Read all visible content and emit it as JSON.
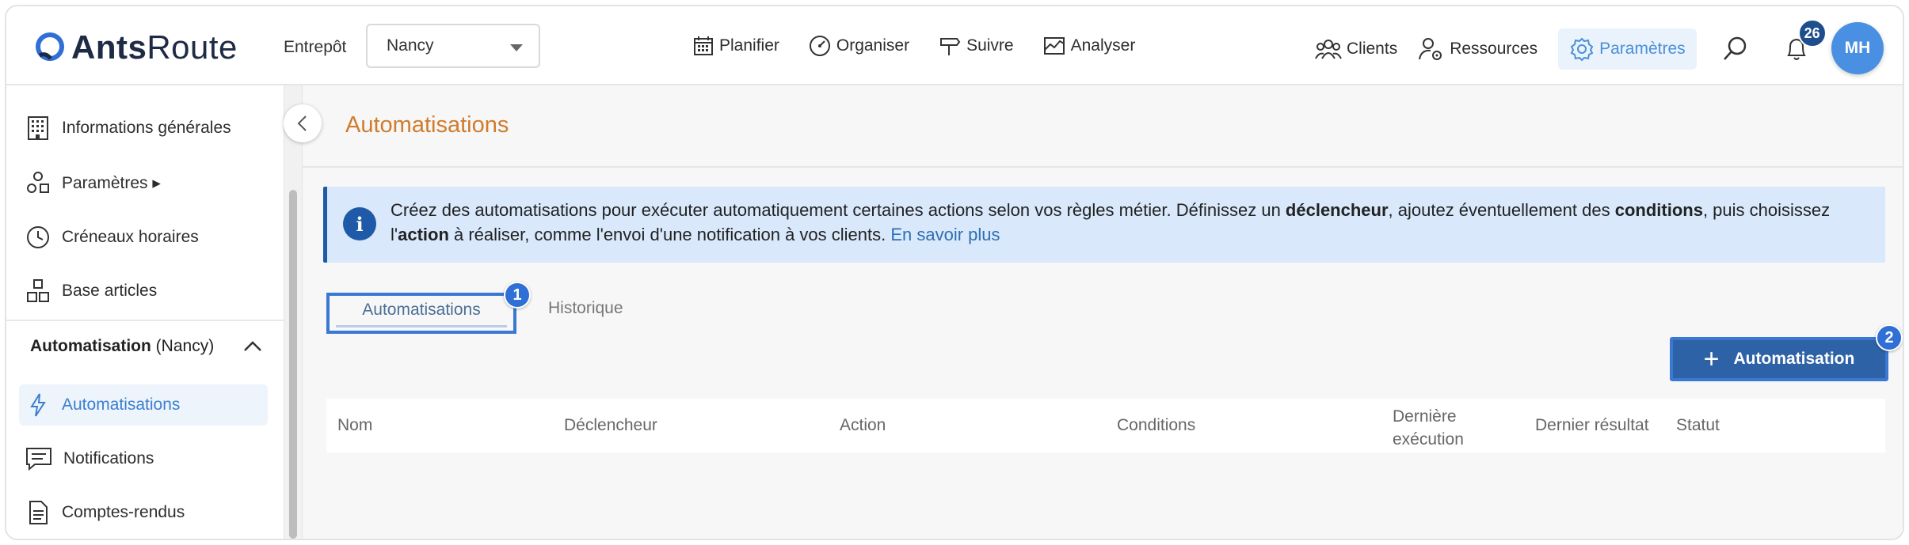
{
  "brand": {
    "name_bold": "Ants",
    "name_light": "Route"
  },
  "header": {
    "warehouse_label": "Entrepôt",
    "warehouse_value": "Nancy",
    "nav": [
      {
        "label": "Planifier",
        "icon": "calendar-icon"
      },
      {
        "label": "Organiser",
        "icon": "speedometer-icon"
      },
      {
        "label": "Suivre",
        "icon": "signpost-icon"
      },
      {
        "label": "Analyser",
        "icon": "chart-icon"
      }
    ],
    "nav_right": [
      {
        "label": "Clients",
        "icon": "users-icon"
      },
      {
        "label": "Ressources",
        "icon": "user-gear-icon"
      },
      {
        "label": "Paramètres",
        "icon": "gear-icon"
      }
    ],
    "notifications_count": "26",
    "avatar_initials": "MH"
  },
  "sidebar": {
    "items": [
      {
        "label": "Informations générales"
      },
      {
        "label": "Paramètres ▸"
      },
      {
        "label": "Créneaux horaires"
      },
      {
        "label": "Base articles"
      }
    ],
    "group_bold": "Automatisation",
    "group_rest": " (Nancy)",
    "sub_items": [
      {
        "label": "Automatisations"
      },
      {
        "label": "Notifications"
      },
      {
        "label": "Comptes-rendus"
      }
    ]
  },
  "main": {
    "title": "Automatisations",
    "info": {
      "t1": "Créez des automatisations pour exécuter automatiquement certaines actions selon vos règles métier. Définissez un ",
      "b1": "déclencheur",
      "t2": ", ajoutez éventuellement des ",
      "b2": "conditions",
      "t3": ", puis choisissez l'",
      "b3": "action",
      "t4": " à réaliser, comme l'envoi d'une notification à vos clients. ",
      "link": "En savoir plus"
    },
    "tabs": [
      {
        "label": "Automatisations"
      },
      {
        "label": "Historique"
      }
    ],
    "markers": [
      "1",
      "2"
    ],
    "add_button": "Automatisation",
    "columns": [
      "Nom",
      "Déclencheur",
      "Action",
      "Conditions",
      "Dernière",
      "exécution",
      "Dernier résultat",
      "Statut"
    ]
  },
  "colors": {
    "accent": "#2e62a7",
    "title": "#d17b2c",
    "info_bg": "#d9e8fb"
  }
}
